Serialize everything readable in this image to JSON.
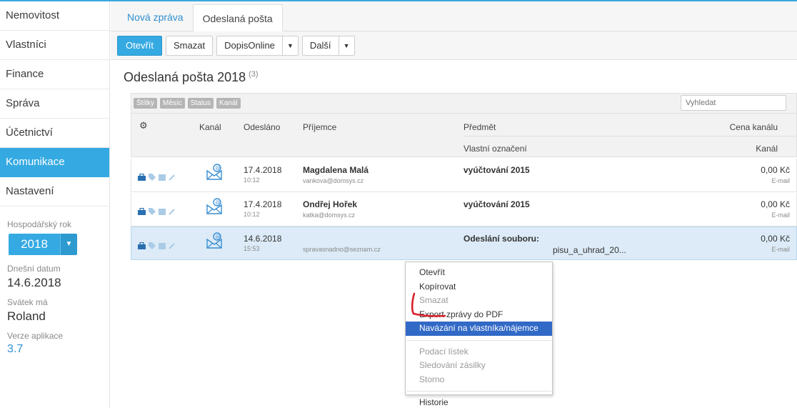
{
  "colors": {
    "accent": "#35aae2",
    "menu_highlight": "#3169c6",
    "selected_row": "#dcebf7",
    "annotation": "#d9202a"
  },
  "sidebar": {
    "items": [
      {
        "label": "Nemovitost",
        "active": false
      },
      {
        "label": "Vlastníci",
        "active": false
      },
      {
        "label": "Finance",
        "active": false
      },
      {
        "label": "Správa",
        "active": false
      },
      {
        "label": "Účetnictví",
        "active": false
      },
      {
        "label": "Komunikace",
        "active": true
      },
      {
        "label": "Nastavení",
        "active": false
      }
    ],
    "fiscal_year_label": "Hospodářský rok",
    "fiscal_year_value": "2018",
    "today_label": "Dnešní datum",
    "today_value": "14.6.2018",
    "nameday_label": "Svátek má",
    "nameday_value": "Roland",
    "version_label": "Verze aplikace",
    "version_value": "3.7"
  },
  "tabs": [
    {
      "label": "Nová zpráva",
      "active": false
    },
    {
      "label": "Odeslaná pošta",
      "active": true
    }
  ],
  "toolbar": {
    "open_label": "Otevřít",
    "delete_label": "Smazat",
    "dopis_label": "DopisOnline",
    "more_label": "Další"
  },
  "page": {
    "title": "Odeslaná pošta 2018",
    "count": "(3)"
  },
  "filters": [
    "Štítky",
    "Měsíc",
    "Status",
    "Kanál"
  ],
  "search": {
    "placeholder": "Vyhledat"
  },
  "table": {
    "headers": {
      "gear": "gear-icon",
      "channel": "Kanál",
      "sent": "Odesláno",
      "recipient": "Příjemce",
      "subject": "Předmět",
      "subject_sub": "Vlastní označení",
      "price": "Cena kanálu",
      "price_sub": "Kanál"
    },
    "rows": [
      {
        "date": "17.4.2018",
        "time": "10:12",
        "name": "Magdalena Malá",
        "email": "vankova@domsys.cz",
        "subject": "vyúčtování 2015",
        "subject_sub": "",
        "price": "0,00 Kč",
        "channel": "E-mail",
        "selected": false
      },
      {
        "date": "17.4.2018",
        "time": "10:12",
        "name": "Ondřej Hořek",
        "email": "katka@domsys.cz",
        "subject": "vyúčtování 2015",
        "subject_sub": "",
        "price": "0,00 Kč",
        "channel": "E-mail",
        "selected": false
      },
      {
        "date": "14.6.2018",
        "time": "15:53",
        "name": "",
        "email": "spravasnadno@seznam.cz",
        "subject": "Odeslání souboru:",
        "subject_sub": "pisu_a_uhrad_20...",
        "price": "0,00 Kč",
        "channel": "E-mail",
        "selected": true
      }
    ]
  },
  "context_menu": {
    "items": [
      {
        "label": "Otevřít",
        "disabled": false
      },
      {
        "label": "Kopírovat",
        "disabled": false
      },
      {
        "label": "Smazat",
        "disabled": true
      },
      {
        "label": "Export zprávy do PDF",
        "disabled": false
      },
      {
        "label": "Navázání na vlastníka/nájemce",
        "disabled": false,
        "highlighted": true
      },
      {
        "label": "Podací lístek",
        "disabled": true
      },
      {
        "label": "Sledování zásilky",
        "disabled": true
      },
      {
        "label": "Storno",
        "disabled": true
      },
      {
        "label": "Historie",
        "disabled": false
      }
    ]
  }
}
